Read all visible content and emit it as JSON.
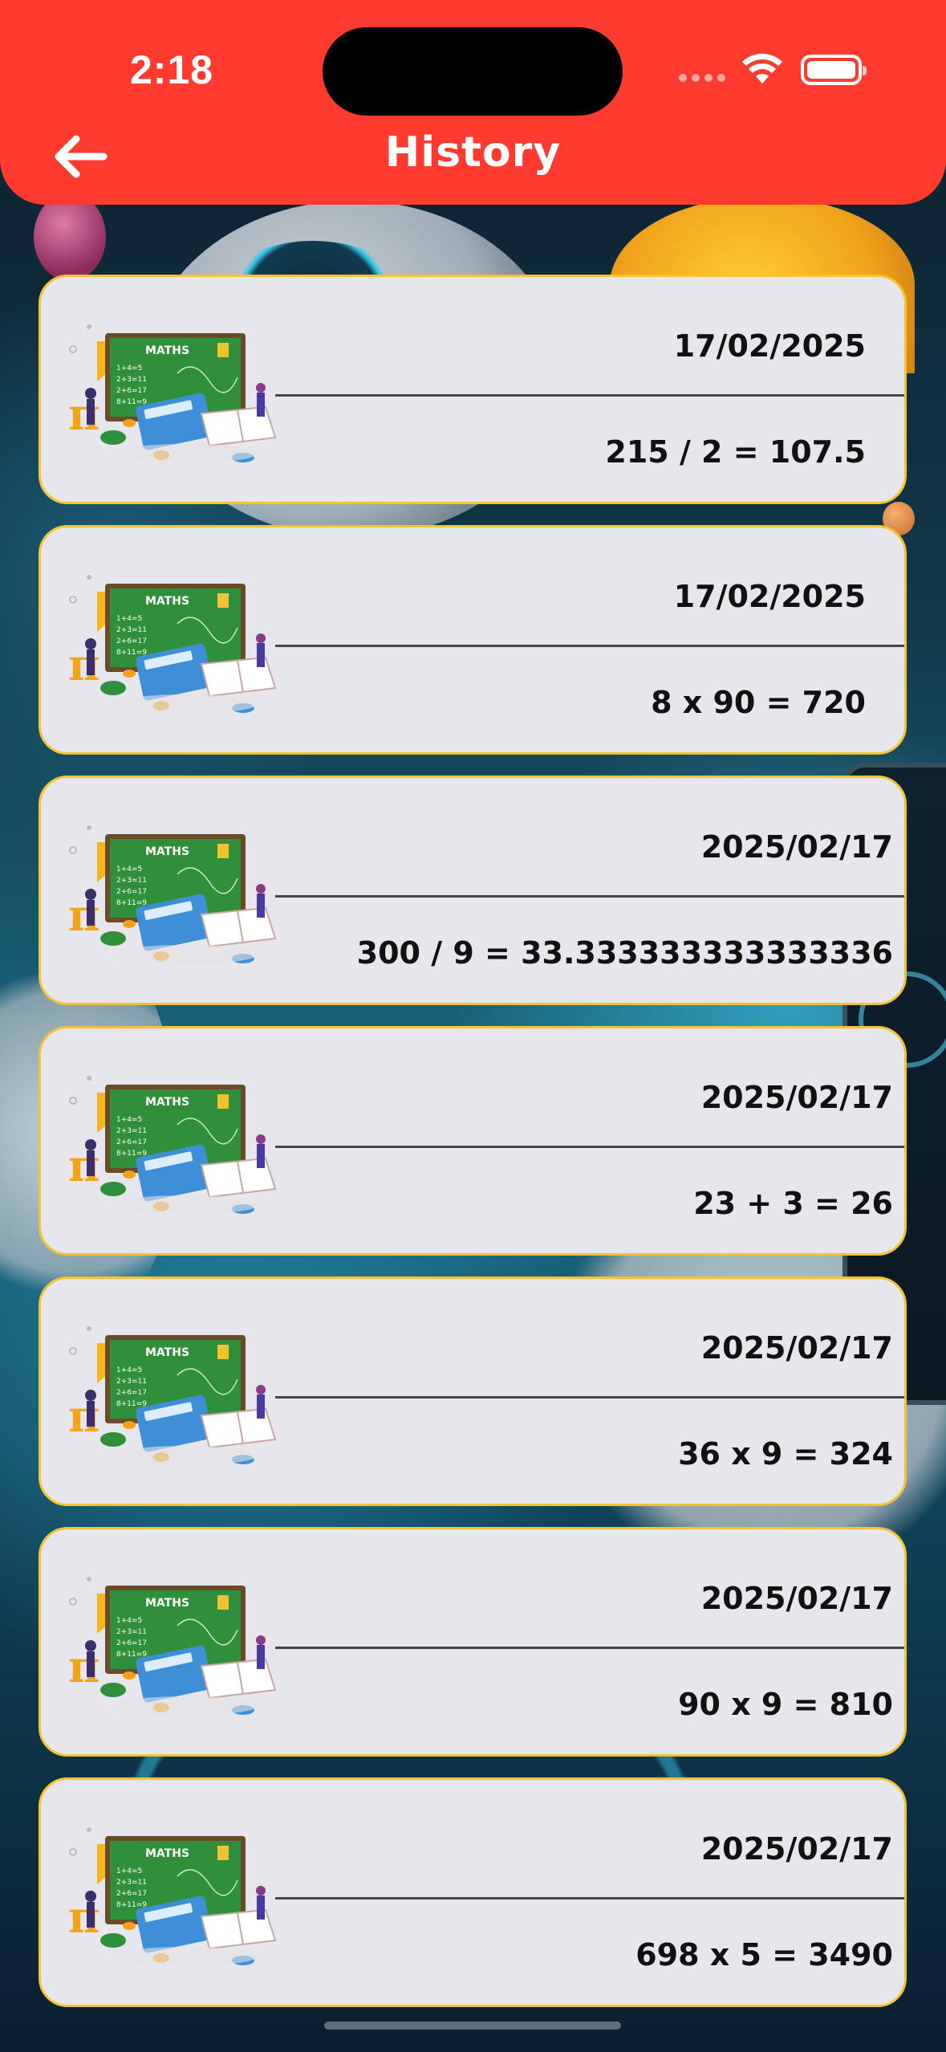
{
  "status_bar": {
    "time": "2:18",
    "icons": [
      "signal-dots",
      "wifi-icon",
      "battery-icon"
    ]
  },
  "header": {
    "title": "History",
    "back_icon": "arrow-left-icon",
    "background_color": "#ff3b30"
  },
  "card_style": {
    "background_color": "#e6e6ec",
    "border_color": "#f4c430",
    "thumbnail": "maths-chalkboard-illustration"
  },
  "history": {
    "items": [
      {
        "date": "17/02/2025",
        "result": "215 / 2 = 107.5"
      },
      {
        "date": "17/02/2025",
        "result": "8 x 90 = 720"
      },
      {
        "date": "2025/02/17",
        "result": "300 / 9 = 33.333333333333336"
      },
      {
        "date": "2025/02/17",
        "result": "23 + 3 = 26"
      },
      {
        "date": "2025/02/17",
        "result": "36 x 9 = 324"
      },
      {
        "date": "2025/02/17",
        "result": "90 x 9 = 810"
      },
      {
        "date": "2025/02/17",
        "result": "698 x 5 = 3490"
      }
    ]
  },
  "thumbnail_text": {
    "board_title": "MATHS",
    "lines": [
      "1+4=5",
      "2+3=11",
      "2+6=17",
      "8+11=9"
    ]
  }
}
